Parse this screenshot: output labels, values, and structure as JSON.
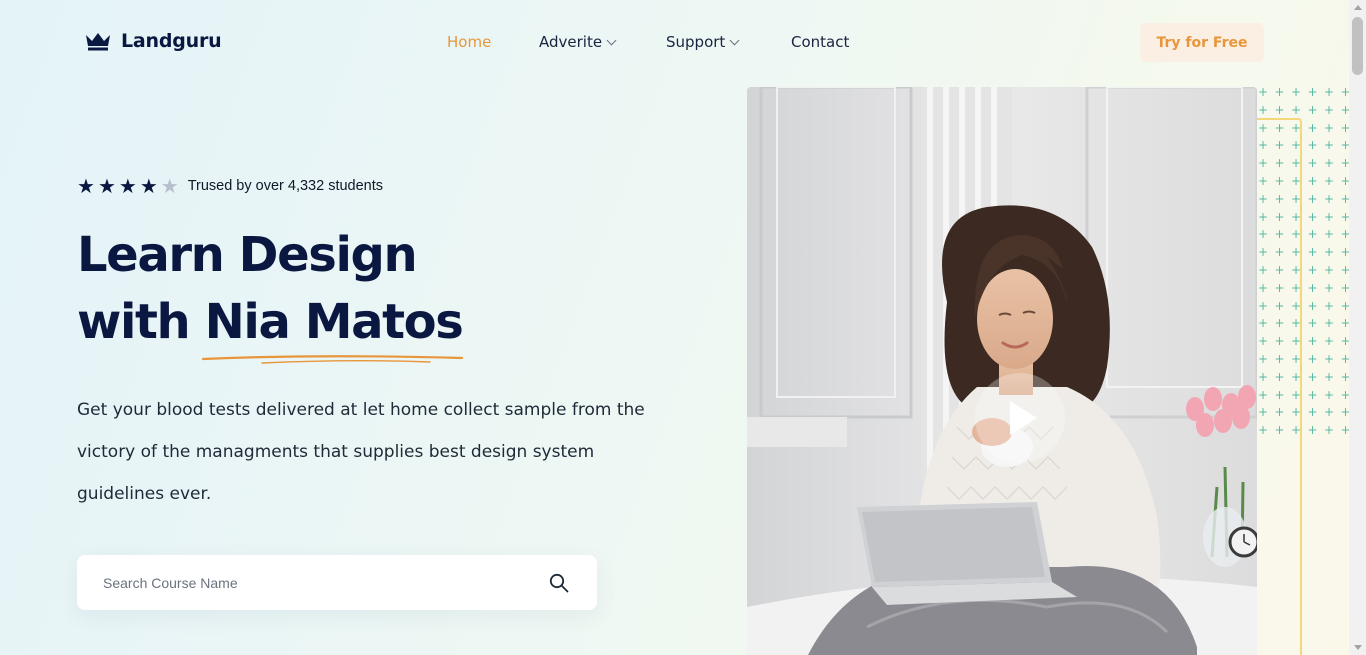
{
  "header": {
    "brand": "Landguru",
    "logo_icon": "crown-icon",
    "nav": [
      {
        "label": "Home",
        "active": true,
        "dropdown": false
      },
      {
        "label": "Adverite",
        "active": false,
        "dropdown": true
      },
      {
        "label": "Support",
        "active": false,
        "dropdown": true
      },
      {
        "label": "Contact",
        "active": false,
        "dropdown": false
      }
    ],
    "cta_label": "Try for Free"
  },
  "hero": {
    "rating": {
      "stars_filled": 4,
      "stars_total": 5,
      "text": "Trused by over 4,332 students"
    },
    "headline_line1": "Learn Design",
    "headline_line2": "with Nia Matos",
    "description_line1": "Get your blood tests delivered at let home collect sample from the",
    "description_line2": "victory of the managments that supplies best design system",
    "description_line3": "guidelines ever.",
    "search": {
      "placeholder": "Search Course Name",
      "value": "",
      "icon": "search-icon"
    },
    "video": {
      "play_icon": "play-icon"
    }
  },
  "colors": {
    "accent": "#e8963b",
    "navy": "#0a1741",
    "cta_bg": "#fbeee2",
    "dots": "#58b8a3",
    "frame": "#f4d77c"
  }
}
